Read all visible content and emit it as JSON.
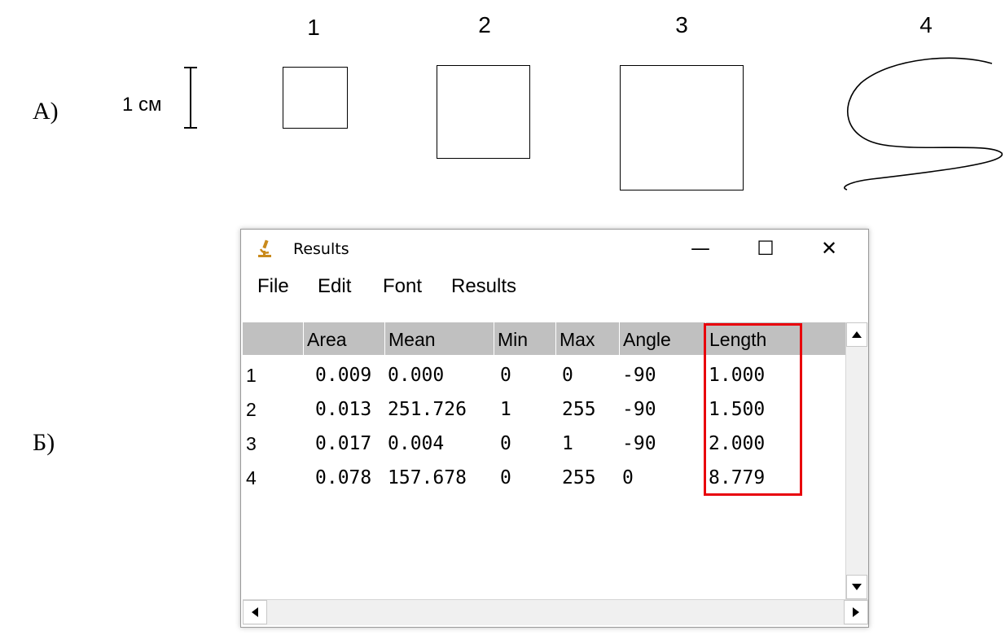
{
  "figure": {
    "panel_a_label": "A)",
    "panel_b_label": "Б)",
    "scale_label": "1 см",
    "shape_numbers": [
      "1",
      "2",
      "3",
      "4"
    ]
  },
  "window": {
    "title": "Results",
    "icon": "microscope-icon",
    "buttons": {
      "minimize": "—",
      "maximize": "☐",
      "close": "✕"
    }
  },
  "menu": [
    "File",
    "Edit",
    "Font",
    "Results"
  ],
  "table": {
    "columns": [
      "",
      "Area",
      "Mean",
      "Min",
      "Max",
      "Angle",
      "Length"
    ],
    "rows": [
      [
        "1",
        "0.009",
        "0.000",
        "0",
        "0",
        "-90",
        "1.000"
      ],
      [
        "2",
        "0.013",
        "251.726",
        "1",
        "255",
        "-90",
        "1.500"
      ],
      [
        "3",
        "0.017",
        "0.004",
        "0",
        "1",
        "-90",
        "2.000"
      ],
      [
        "4",
        "0.078",
        "157.678",
        "0",
        "255",
        "0",
        "8.779"
      ]
    ]
  },
  "colors": {
    "highlight": "#e8000b",
    "header_bg": "#c0c0c0"
  }
}
